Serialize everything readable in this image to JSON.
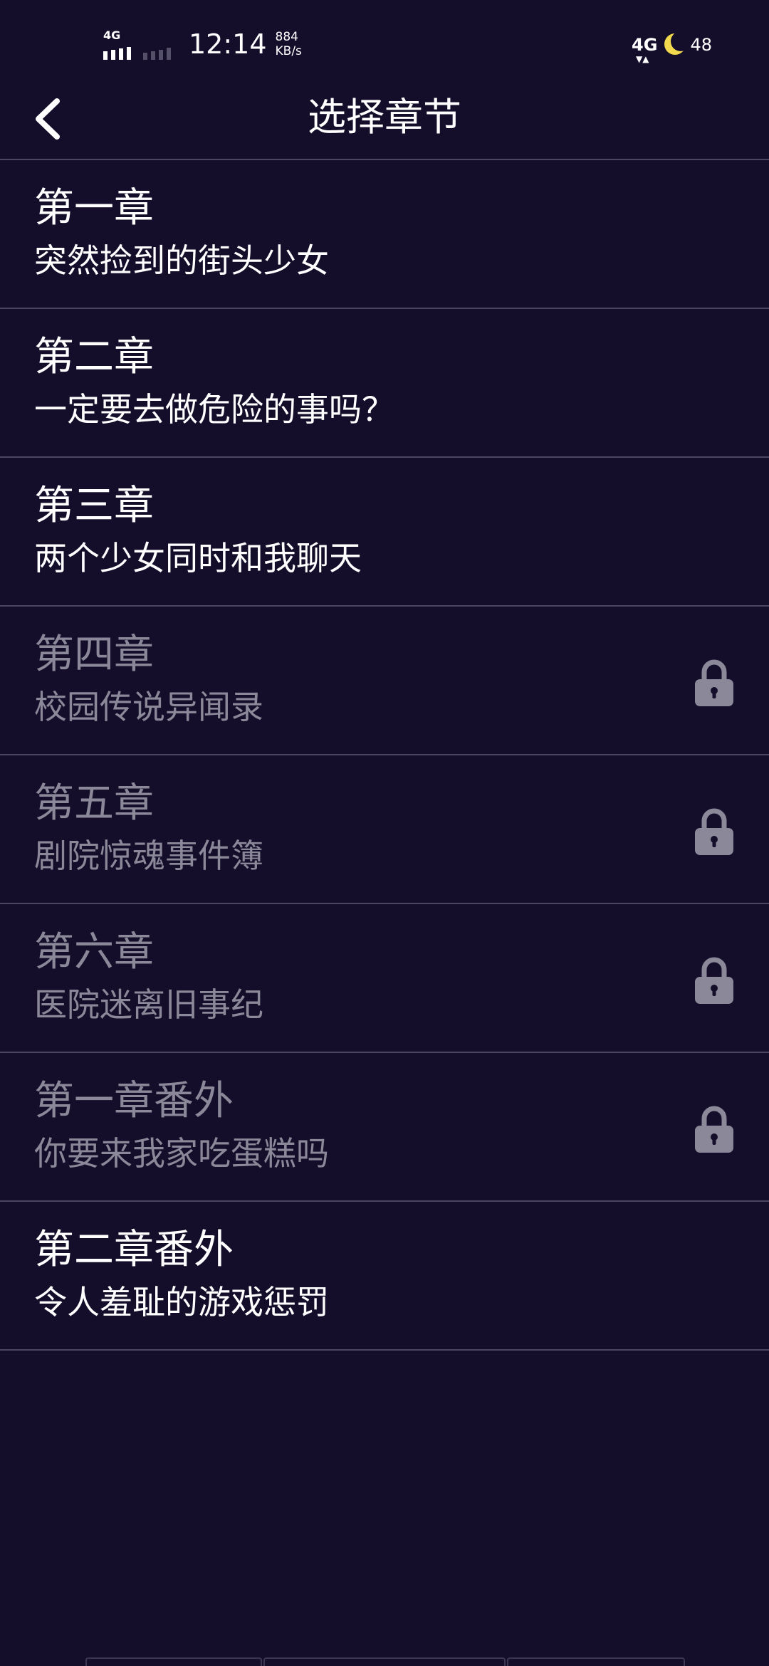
{
  "status_bar": {
    "signal_label": "4G",
    "time": "12:14",
    "speed_value": "884",
    "speed_unit": "KB/s",
    "network_label": "4G",
    "battery": "48"
  },
  "header": {
    "title": "选择章节",
    "back_icon": "chevron-left-icon"
  },
  "chapters": [
    {
      "title": "第一章",
      "subtitle": "突然捡到的街头少女",
      "locked": false
    },
    {
      "title": "第二章",
      "subtitle": "一定要去做危险的事吗？",
      "locked": false
    },
    {
      "title": "第三章",
      "subtitle": "两个少女同时和我聊天",
      "locked": false
    },
    {
      "title": "第四章",
      "subtitle": "校园传说异闻录",
      "locked": true
    },
    {
      "title": "第五章",
      "subtitle": "剧院惊魂事件簿",
      "locked": true
    },
    {
      "title": "第六章",
      "subtitle": "医院迷离旧事纪",
      "locked": true
    },
    {
      "title": "第一章番外",
      "subtitle": "你要来我家吃蛋糕吗",
      "locked": true
    },
    {
      "title": "第二章番外",
      "subtitle": "令人羞耻的游戏惩罚",
      "locked": false
    }
  ],
  "colors": {
    "background": "#140e2a",
    "text_primary": "#ffffff",
    "text_locked": "#8b8899",
    "divider": "#4a4560",
    "lock_icon": "#8b8899"
  }
}
